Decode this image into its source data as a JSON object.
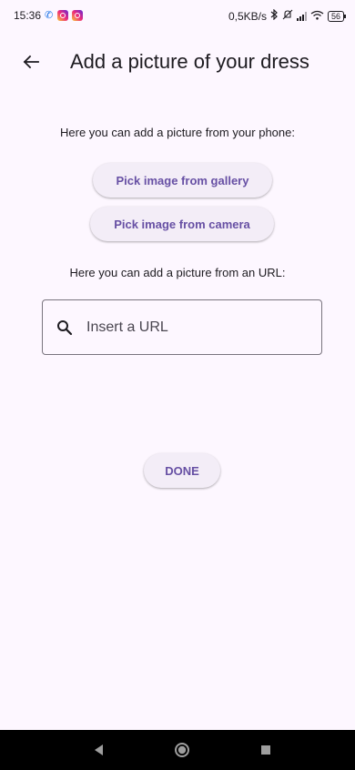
{
  "status_bar": {
    "time": "15:36",
    "net_speed": "0,5KB/s",
    "battery": "56"
  },
  "app_bar": {
    "title": "Add a picture of your dress",
    "back_icon": "arrow-back-icon"
  },
  "content": {
    "phone_hint": "Here you can add a picture from your phone:",
    "gallery_button": "Pick image from gallery",
    "camera_button": "Pick image from camera",
    "url_hint": "Here you can add a picture from an URL:",
    "url_field": {
      "placeholder": "Insert a URL",
      "value": "",
      "icon": "search-icon"
    },
    "done_button": "DONE"
  },
  "colors": {
    "background": "#fdf7ff",
    "button_bg": "#f3edf7",
    "button_text": "#6750a4",
    "outline": "#79747e"
  }
}
